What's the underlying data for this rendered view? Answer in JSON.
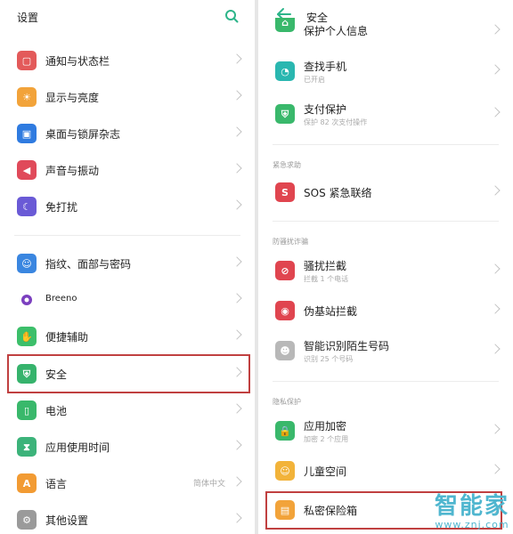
{
  "left": {
    "title": "设置",
    "items": [
      {
        "label": "通知与状态栏",
        "icon": "notification-icon",
        "color": "#e35a5a"
      },
      {
        "label": "显示与亮度",
        "icon": "brightness-icon",
        "color": "#f2a33a"
      },
      {
        "label": "桌面与锁屏杂志",
        "icon": "wallpaper-icon",
        "color": "#2f7be0"
      },
      {
        "label": "声音与振动",
        "icon": "sound-icon",
        "color": "#e04a5a"
      },
      {
        "label": "免打扰",
        "icon": "moon-icon",
        "color": "#6a5ad6"
      },
      {
        "label": "指纹、面部与密码",
        "icon": "fingerprint-icon",
        "color": "#3a86e0"
      },
      {
        "label": "Breeno",
        "icon": "breeno-icon",
        "color": "#ffffff"
      },
      {
        "label": "便捷辅助",
        "icon": "assist-icon",
        "color": "#3cbf6a"
      },
      {
        "label": "安全",
        "icon": "shield-icon",
        "color": "#36b36c"
      },
      {
        "label": "电池",
        "icon": "battery-icon",
        "color": "#39b86b"
      },
      {
        "label": "应用使用时间",
        "icon": "hourglass-icon",
        "color": "#3cb37a"
      },
      {
        "label": "语言",
        "icon": "language-icon",
        "color": "#f29b33"
      },
      {
        "label": "其他设置",
        "icon": "more-settings-icon",
        "color": "#9a9a9a"
      }
    ],
    "language_value": "简体中文"
  },
  "right": {
    "title": "安全",
    "items": [
      {
        "label": "保护个人信息",
        "icon": "privacy-icon",
        "color": "#39b86b"
      },
      {
        "label": "查找手机",
        "sub": "已开启",
        "icon": "find-phone-icon",
        "color": "#2ab7b0"
      },
      {
        "label": "支付保护",
        "sub": "保护 82 次支付操作",
        "icon": "payment-shield-icon",
        "color": "#39b86b"
      },
      {
        "label": "SOS 紧急联络",
        "icon": "sos-icon",
        "color": "#e0454f"
      },
      {
        "label": "骚扰拦截",
        "sub": "拦截 1 个电话",
        "icon": "block-icon",
        "color": "#e0454f"
      },
      {
        "label": "伪基站拦截",
        "icon": "tower-icon",
        "color": "#e0454f"
      },
      {
        "label": "智能识别陌生号码",
        "sub": "识别 25 个号码",
        "icon": "contact-icon",
        "color": "#b8b8b8"
      },
      {
        "label": "应用加密",
        "sub": "加密 2 个应用",
        "icon": "lock-icon",
        "color": "#39b86b"
      },
      {
        "label": "儿童空间",
        "icon": "kids-icon",
        "color": "#f2b33a"
      },
      {
        "label": "私密保险箱",
        "icon": "safe-box-icon",
        "color": "#f2a33a"
      }
    ],
    "sections": {
      "emergency": "紧急求助",
      "anti_harassment": "防骚扰诈骗",
      "privacy": "隐私保护"
    }
  },
  "watermark": {
    "brand": "智能家",
    "url": "www.znj.com"
  }
}
